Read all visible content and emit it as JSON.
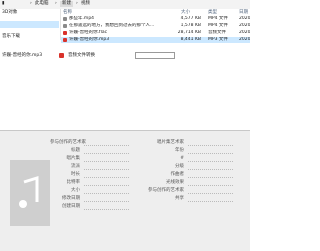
{
  "address": {
    "drive": "此电脑",
    "folder1": "新建",
    "folder2": "视频"
  },
  "nav": {
    "items": [
      "3D对象",
      "",
      "音乐下载"
    ]
  },
  "list": {
    "headers": {
      "name": "名称",
      "size": "大小",
      "type": "类型",
      "date": "日期"
    },
    "rows": [
      {
        "name": "那些年.mp4",
        "size": "4,577 KB",
        "type": "MP4 文件",
        "date": "2020"
      },
      {
        "name": "在那遥远的地方，我想回到过去的那个人...",
        "size": "1,578 KB",
        "type": "MP4 文件",
        "date": "2020"
      },
      {
        "name": "许巍-曾经的你.flac",
        "size": "28,714 KB",
        "type": "音频文件",
        "date": "2020"
      },
      {
        "name": "许巍-曾经的你.mp3",
        "size": "8,441 KB",
        "type": "MP3 文件",
        "date": "2020"
      }
    ]
  },
  "rename": {
    "filename": "许巍-曾经的你.mp3",
    "status": "音频文件转换"
  },
  "details": {
    "left_labels": [
      "参与创作的艺术家",
      "标题",
      "唱片集",
      "流派",
      "时长",
      "比特率",
      "大小",
      "修改日期",
      "创建日期"
    ],
    "right_labels": [
      "唱片集艺术家",
      "年份",
      "#",
      "分级",
      "作曲者",
      "光线效果",
      "参与创作的艺术家",
      "共享"
    ]
  },
  "colors": {
    "selection": "#cce8ff",
    "pdf_icon": "#d9322b",
    "mp4_icon": "#c0392b"
  }
}
